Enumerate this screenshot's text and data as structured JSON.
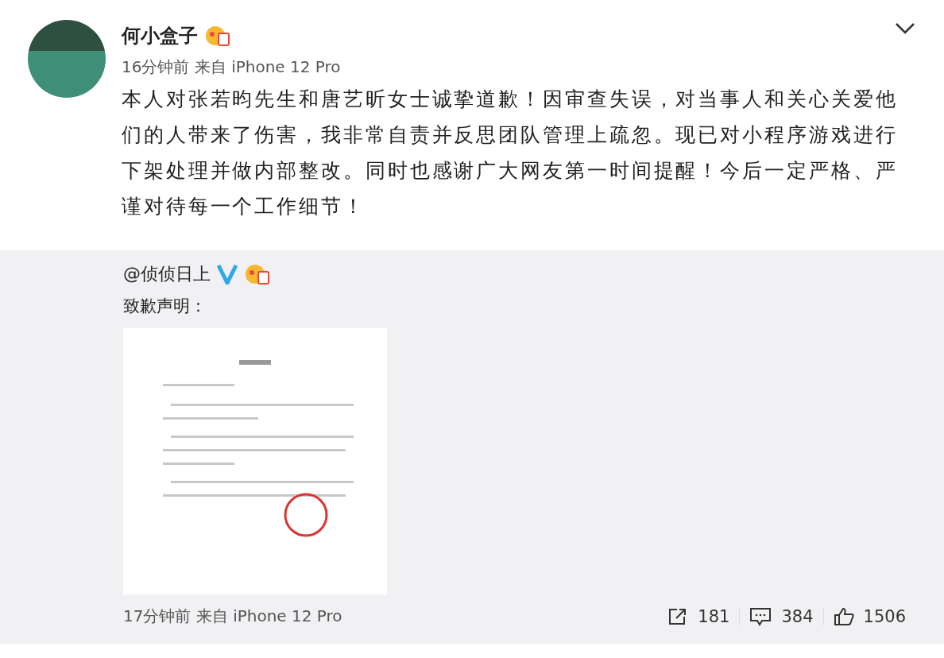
{
  "post": {
    "author": "何小盒子",
    "time_source": "16分钟前 来自 iPhone 12 Pro",
    "text": "本人对张若昀先生和唐艺昕女士诚挚道歉！因审查失误，对当事人和关心关爱他们的人带来了伤害，我非常自责并反思团队管理上疏忽。现已对小程序游戏进行下架处理并做内部整改。同时也感谢广大网友第一时间提醒！今后一定严格、严谨对待每一个工作细节！"
  },
  "repost": {
    "author": "@侦侦日上",
    "verified": true,
    "text": "致歉声明：",
    "time_source": "17分钟前 来自 iPhone 12 Pro",
    "actions": [
      {
        "kind": "share",
        "count": "181"
      },
      {
        "kind": "comment",
        "count": "384"
      },
      {
        "kind": "like",
        "count": "1506"
      }
    ]
  }
}
